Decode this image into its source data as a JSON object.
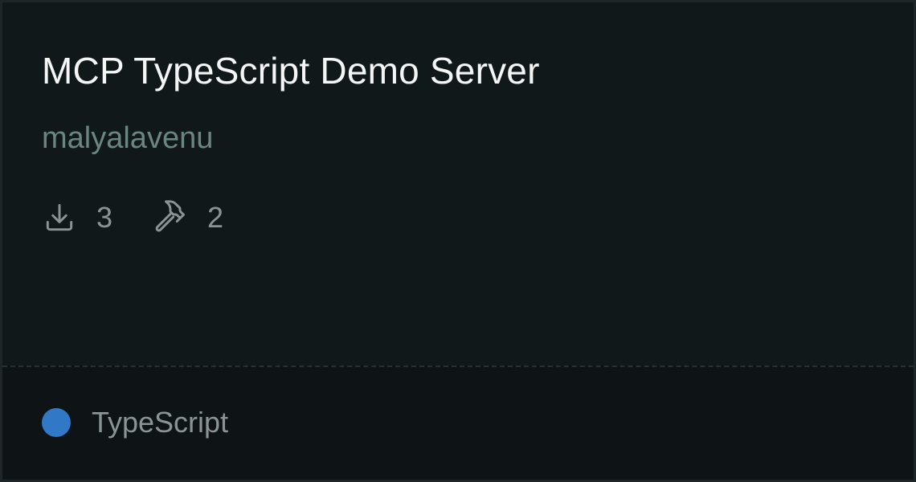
{
  "server": {
    "title": "MCP TypeScript Demo Server",
    "author": "malyalavenu"
  },
  "stats": {
    "downloads": {
      "icon": "download-icon",
      "value": "3"
    },
    "tools": {
      "icon": "hammer-icon",
      "value": "2"
    }
  },
  "language": {
    "name": "TypeScript",
    "color": "#3178c6"
  },
  "colors": {
    "background": "#11181a",
    "footer_background": "#0e1416",
    "title": "#f4f6f6",
    "author": "#6b8583",
    "muted": "#8a9496"
  }
}
